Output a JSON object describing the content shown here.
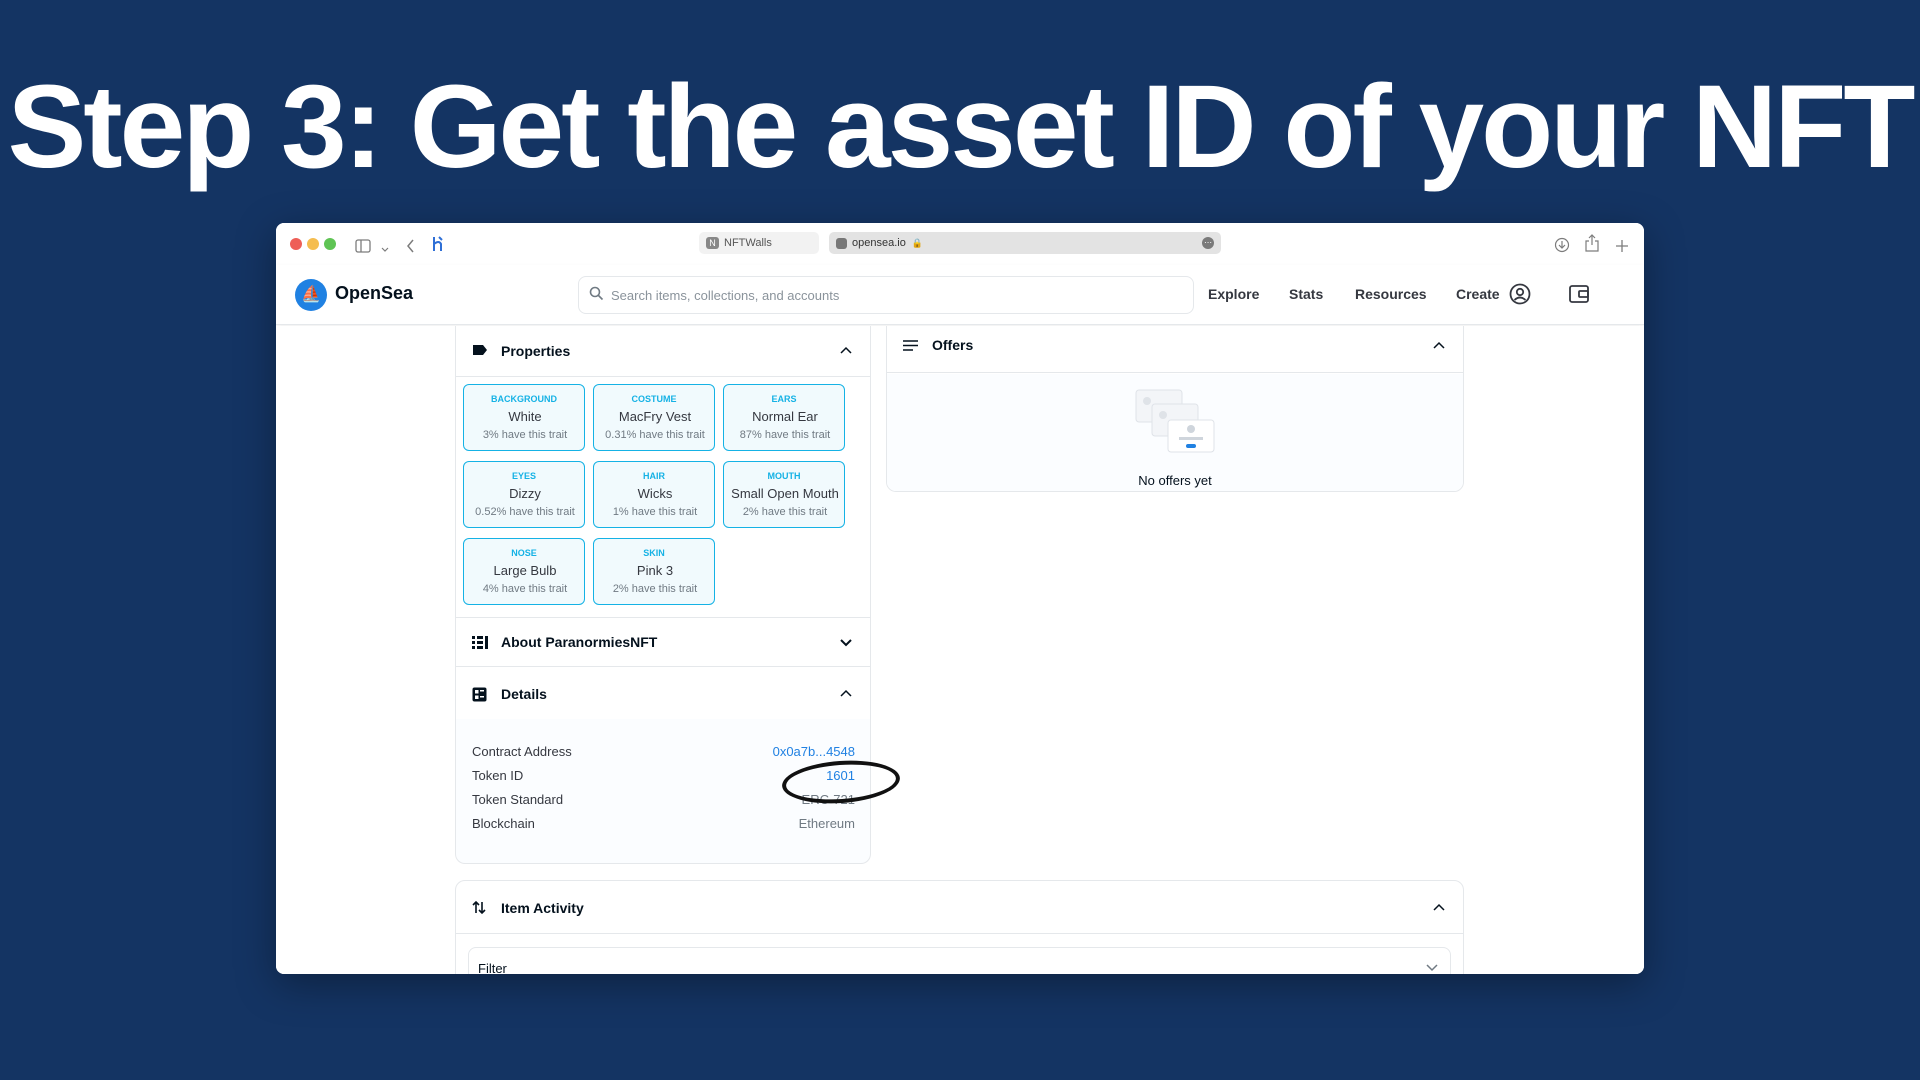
{
  "slide": {
    "title": "Step 3: Get the asset ID of your NFT"
  },
  "browser": {
    "tabs": [
      {
        "label": "NFTWalls",
        "favicon_letter": "N"
      },
      {
        "label": "opensea.io"
      }
    ]
  },
  "header": {
    "brand": "OpenSea",
    "search_placeholder": "Search items, collections, and accounts",
    "nav": [
      "Explore",
      "Stats",
      "Resources",
      "Create"
    ]
  },
  "properties": {
    "title": "Properties",
    "traits": [
      {
        "type": "BACKGROUND",
        "value": "White",
        "rarity": "3% have this trait"
      },
      {
        "type": "COSTUME",
        "value": "MacFry Vest",
        "rarity": "0.31% have this trait"
      },
      {
        "type": "EARS",
        "value": "Normal Ear",
        "rarity": "87% have this trait"
      },
      {
        "type": "EYES",
        "value": "Dizzy",
        "rarity": "0.52% have this trait"
      },
      {
        "type": "HAIR",
        "value": "Wicks",
        "rarity": "1% have this trait"
      },
      {
        "type": "MOUTH",
        "value": "Small Open Mouth",
        "rarity": "2% have this trait"
      },
      {
        "type": "NOSE",
        "value": "Large Bulb",
        "rarity": "4% have this trait"
      },
      {
        "type": "SKIN",
        "value": "Pink 3",
        "rarity": "2% have this trait"
      }
    ]
  },
  "about": {
    "title": "About ParanormiesNFT"
  },
  "details": {
    "title": "Details",
    "rows": [
      {
        "label": "Contract Address",
        "value": "0x0a7b...4548"
      },
      {
        "label": "Token ID",
        "value": "1601"
      },
      {
        "label": "Token Standard",
        "value": "ERC-721"
      },
      {
        "label": "Blockchain",
        "value": "Ethereum"
      }
    ]
  },
  "offers": {
    "title": "Offers",
    "empty_text": "No offers yet"
  },
  "activity": {
    "title": "Item Activity",
    "filter_label": "Filter"
  }
}
